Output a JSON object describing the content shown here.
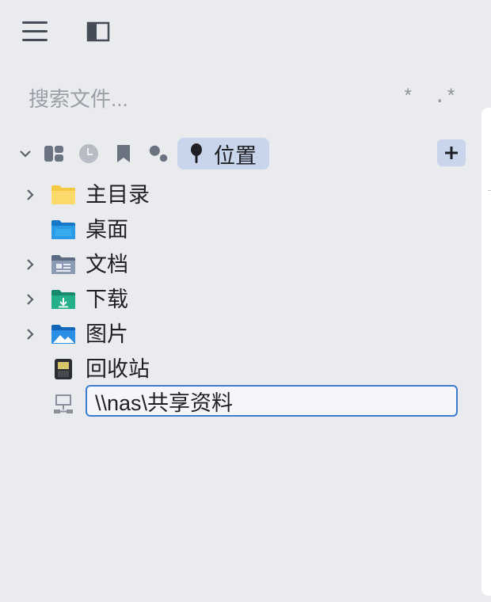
{
  "search": {
    "placeholder": "搜索文件...",
    "glob_label": "*",
    "regex_label": ".*"
  },
  "tabs": {
    "active_label": "位置"
  },
  "tree": {
    "items": [
      {
        "label": "主目录",
        "icon": "home-folder-icon",
        "expandable": true
      },
      {
        "label": "桌面",
        "icon": "desktop-folder-icon",
        "expandable": false
      },
      {
        "label": "文档",
        "icon": "documents-folder-icon",
        "expandable": true
      },
      {
        "label": "下载",
        "icon": "downloads-folder-icon",
        "expandable": true
      },
      {
        "label": "图片",
        "icon": "pictures-folder-icon",
        "expandable": true
      },
      {
        "label": "回收站",
        "icon": "trash-icon",
        "expandable": false
      }
    ],
    "new_location_value": "\\\\nas\\共享资料"
  },
  "colors": {
    "background": "#e9ebef",
    "accent": "#3d7bd0",
    "active_tab": "#c8d5ea"
  }
}
